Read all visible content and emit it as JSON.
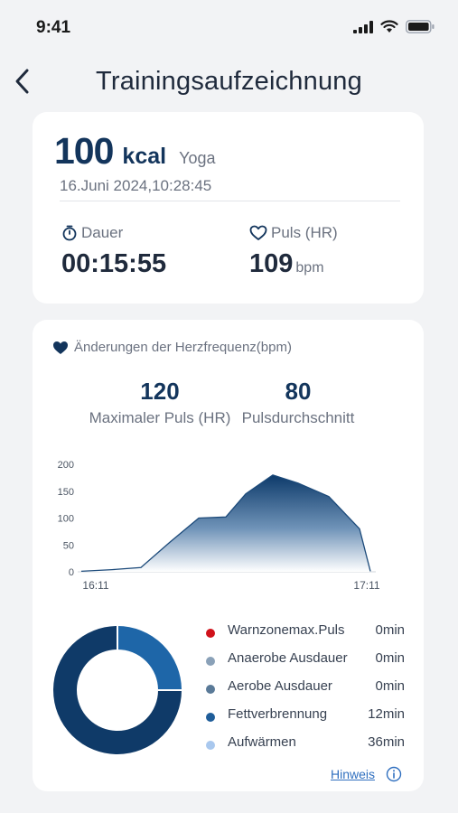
{
  "status": {
    "time": "9:41"
  },
  "nav": {
    "title": "Trainingsaufzeichnung"
  },
  "summary": {
    "kcal_value": "100",
    "kcal_unit": "kcal",
    "sport": "Yoga",
    "date": "16.Juni 2024,10:28:45",
    "duration_label": "Dauer",
    "duration_value": "00:15:55",
    "pulse_label": "Puls (HR)",
    "pulse_value": "109",
    "pulse_unit": "bpm"
  },
  "heart": {
    "title": "Änderungen der Herzfrequenz(bpm)",
    "max_value": "120",
    "max_label": "Maximaler Puls (HR)",
    "avg_value": "80",
    "avg_label": "Pulsdurchschnitt"
  },
  "colors": {
    "accent": "#13355c",
    "warn": "#d0121b",
    "anaerob": "#8aa1b8",
    "aerob": "#5a7a98",
    "fett": "#1f5d99",
    "warm": "#a9c8ee",
    "donut_main": "#0f3a68",
    "donut_minor": "#1e66a8"
  },
  "chart_data": {
    "type": "area",
    "x": [
      "16:11",
      "",
      "",
      "",
      "",
      "",
      "",
      "",
      "",
      "",
      "",
      "",
      "17:11"
    ],
    "x_tick_labels": [
      "16:11",
      "17:11"
    ],
    "y": [
      1,
      4,
      8,
      55,
      100,
      102,
      145,
      180,
      165,
      140,
      80,
      1
    ],
    "y_ticks": [
      0,
      50,
      100,
      150,
      200
    ],
    "ylim": [
      0,
      200
    ],
    "grid": false
  },
  "zones": [
    {
      "label": "Warnzonemax.Puls",
      "value": "0min",
      "color": "#d0121b"
    },
    {
      "label": "Anaerobe Ausdauer",
      "value": "0min",
      "color": "#8aa1b8"
    },
    {
      "label": "Aerobe Ausdauer",
      "value": "0min",
      "color": "#5a7a98"
    },
    {
      "label": "Fettverbrennung",
      "value": "12min",
      "color": "#1f5d99"
    },
    {
      "label": "Aufwärmen",
      "value": "36min",
      "color": "#a9c8ee"
    }
  ],
  "donut_data": {
    "fett_minutes": 12,
    "aufwaermen_minutes": 36
  },
  "hint": {
    "label": "Hinweis"
  }
}
